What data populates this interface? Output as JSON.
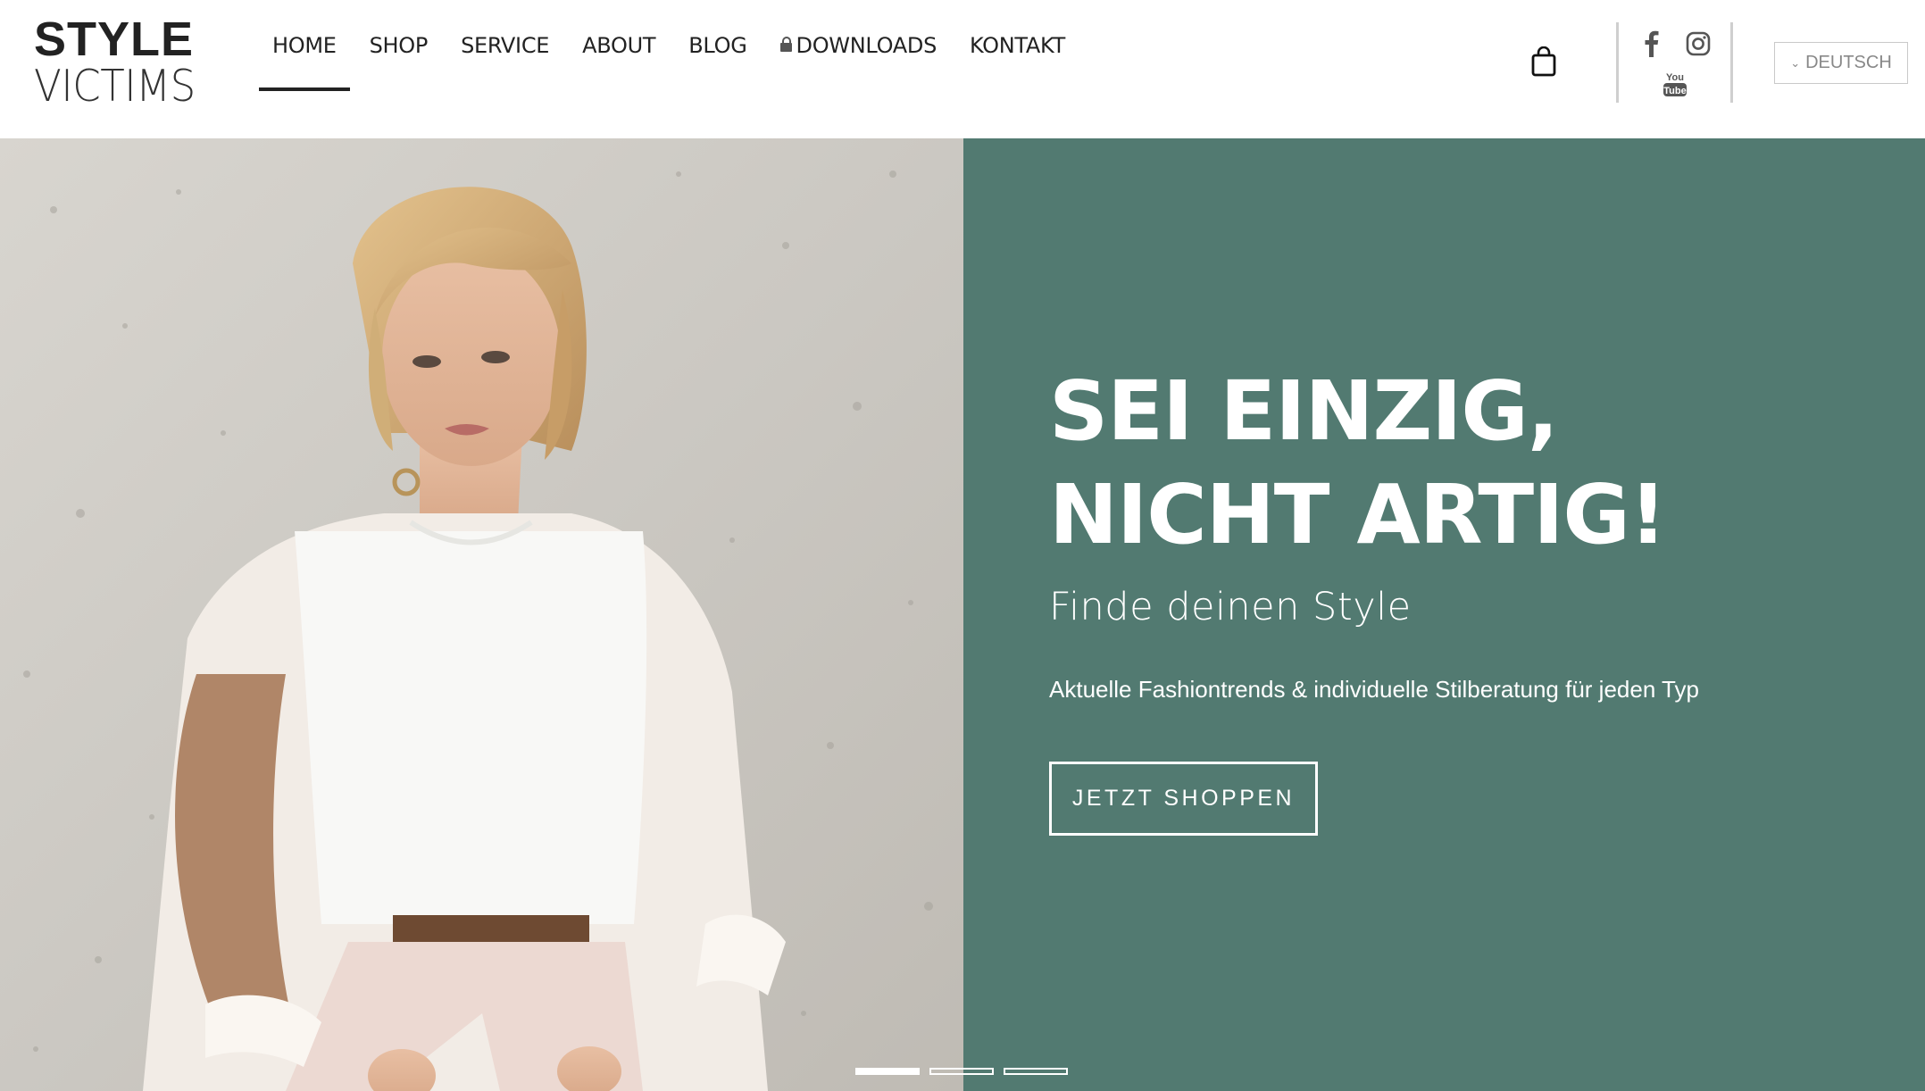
{
  "brand": {
    "line1": "STYLE",
    "line2": "VICTIMS"
  },
  "nav": {
    "items": [
      {
        "label": "HOME"
      },
      {
        "label": "SHOP"
      },
      {
        "label": "SERVICE"
      },
      {
        "label": "ABOUT"
      },
      {
        "label": "BLOG"
      },
      {
        "label": "DOWNLOADS"
      },
      {
        "label": "KONTAKT"
      }
    ],
    "active": "HOME"
  },
  "header": {
    "cart_icon": "shopping-bag-icon",
    "social": [
      "facebook-icon",
      "instagram-icon",
      "youtube-icon"
    ],
    "youtube_text": {
      "you": "You",
      "tube": "Tube"
    },
    "language": "DEUTSCH"
  },
  "hero": {
    "headline_line1": "SEI EINZIG,",
    "headline_line2": "NICHT ARTIG!",
    "subheadline": "Finde deinen Style",
    "tagline": "Aktuelle Fashiontrends & individuelle Stilberatung für jeden Typ",
    "cta_label": "JETZT SHOPPEN",
    "panel_color": "#527a71",
    "slides_total": 3,
    "active_slide": 1
  }
}
